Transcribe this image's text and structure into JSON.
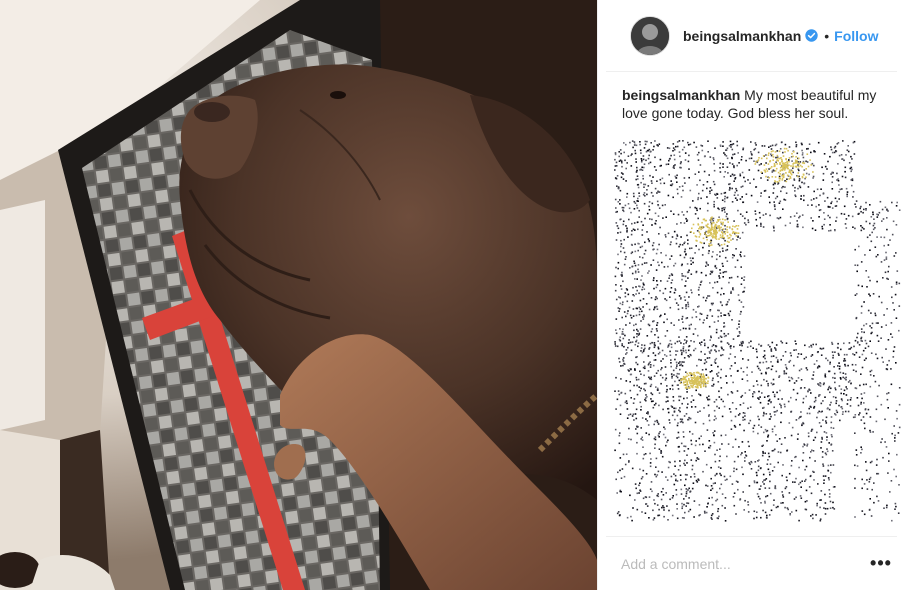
{
  "post": {
    "image": {
      "description_icon": "dog-photo"
    },
    "author": {
      "username": "beingsalmankhan",
      "verified": true,
      "follow_label": "Follow",
      "separator": "•"
    },
    "caption": {
      "username": "beingsalmankhan",
      "text": "My most beautiful my love gone today. God bless her soul."
    },
    "comment_box": {
      "placeholder": "Add a comment..."
    },
    "more_label": "•••"
  },
  "colors": {
    "link": "#3897f0",
    "verified_badge": "#3897f0",
    "divider": "#efefef"
  }
}
